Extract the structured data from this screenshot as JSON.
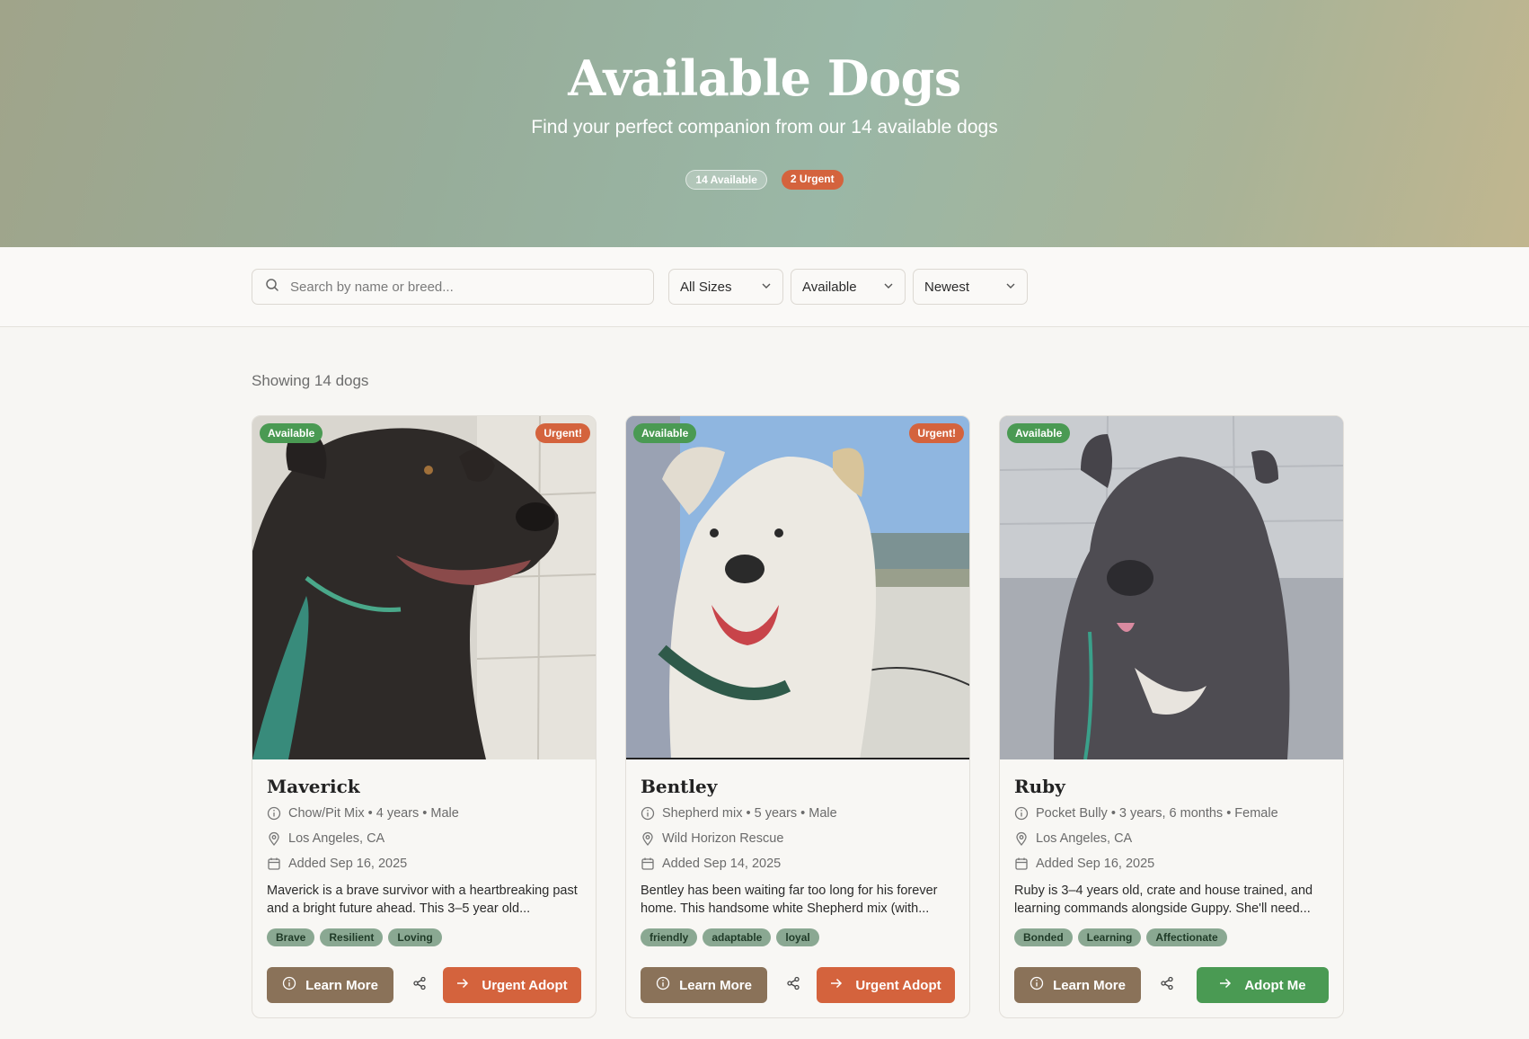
{
  "hero": {
    "title": "Available Dogs",
    "subtitle": "Find your perfect companion from our 14 available dogs",
    "badge_available": "14 Available",
    "badge_urgent": "2 Urgent"
  },
  "filters": {
    "search_placeholder": "Search by name or breed...",
    "size": "All Sizes",
    "status": "Available",
    "sort": "Newest"
  },
  "results": {
    "count_text": "Showing 14 dogs"
  },
  "colors": {
    "available": "#4a9a53",
    "urgent": "#d4633d",
    "learn": "#8a7259",
    "trait": "#8aa892"
  },
  "dogs": [
    {
      "name": "Maverick",
      "status": "Available",
      "urgent_tag": "Urgent!",
      "info": "Chow/Pit Mix • 4 years • Male",
      "location": "Los Angeles, CA",
      "added": "Added Sep 16, 2025",
      "description": "Maverick is a brave survivor with a heartbreaking past and a bright future ahead. This 3–5 year old...",
      "traits": [
        "Brave",
        "Resilient",
        "Loving"
      ],
      "learn_label": "Learn More",
      "adopt_label": "Urgent Adopt"
    },
    {
      "name": "Bentley",
      "status": "Available",
      "urgent_tag": "Urgent!",
      "info": "Shepherd mix • 5 years • Male",
      "location": "Wild Horizon Rescue",
      "added": "Added Sep 14, 2025",
      "description": "Bentley has been waiting far too long for his forever home. This handsome white Shepherd mix (with...",
      "traits": [
        "friendly",
        "adaptable",
        "loyal"
      ],
      "learn_label": "Learn More",
      "adopt_label": "Urgent Adopt"
    },
    {
      "name": "Ruby",
      "status": "Available",
      "info": "Pocket Bully • 3 years, 6 months • Female",
      "location": "Los Angeles, CA",
      "added": "Added Sep 16, 2025",
      "description": "Ruby is 3–4 years old, crate and house trained, and learning commands alongside Guppy. She'll need...",
      "traits": [
        "Bonded",
        "Learning",
        "Affectionate"
      ],
      "learn_label": "Learn More",
      "adopt_label": "Adopt Me"
    }
  ]
}
